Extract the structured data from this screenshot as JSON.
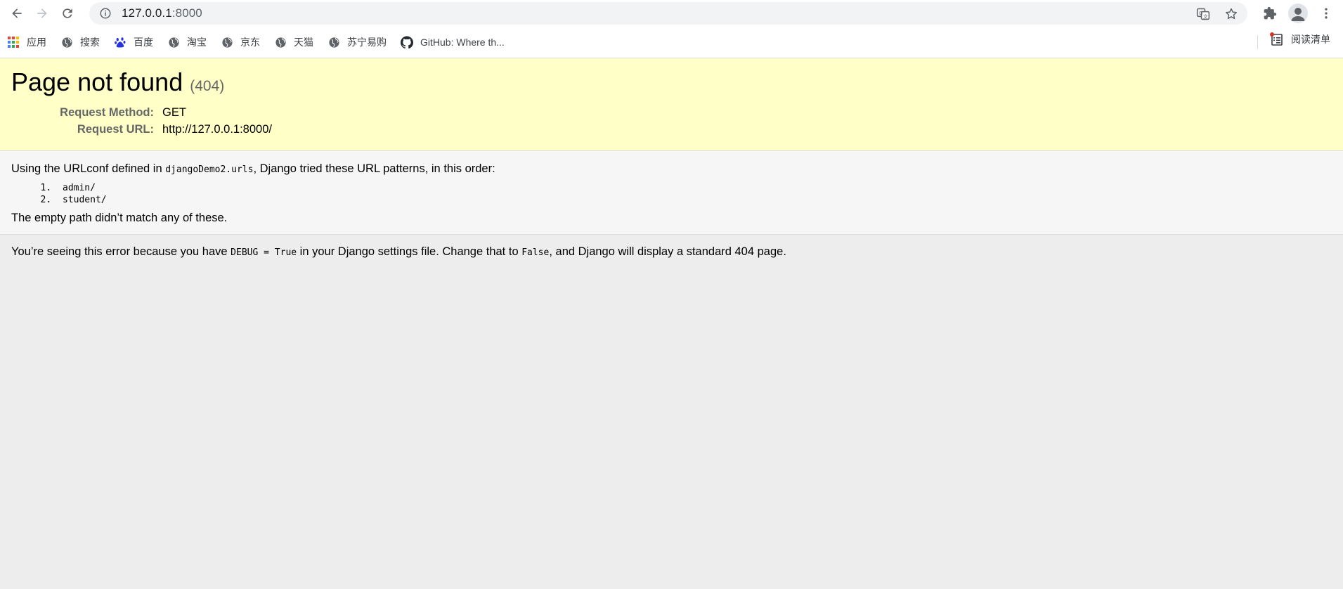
{
  "browser": {
    "url_host": "127.0.0.1",
    "url_port": ":8000",
    "bookmarks": [
      {
        "label": "应用",
        "icon": "apps-grid-icon"
      },
      {
        "label": "搜索",
        "icon": "globe-icon"
      },
      {
        "label": "百度",
        "icon": "baidu-paw-icon"
      },
      {
        "label": "淘宝",
        "icon": "globe-icon"
      },
      {
        "label": "京东",
        "icon": "globe-icon"
      },
      {
        "label": "天猫",
        "icon": "globe-icon"
      },
      {
        "label": "苏宁易购",
        "icon": "globe-icon"
      },
      {
        "label": "GitHub: Where th...",
        "icon": "github-icon"
      }
    ],
    "reading_list_label": "阅读清单"
  },
  "summary": {
    "title": "Page not found",
    "status_code": "(404)",
    "request_method_label": "Request Method:",
    "request_method_value": "GET",
    "request_url_label": "Request URL:",
    "request_url_value": "http://127.0.0.1:8000/"
  },
  "info": {
    "intro_prefix": "Using the URLconf defined in ",
    "urlconf": "djangoDemo2.urls",
    "intro_suffix": ", Django tried these URL patterns, in this order:",
    "patterns": [
      "admin/",
      "student/"
    ],
    "no_match": "The empty path didn’t match any of these."
  },
  "explanation": {
    "part1": "You’re seeing this error because you have ",
    "debug_code": "DEBUG = True",
    "part2": " in your Django settings file. Change that to ",
    "false_code": "False",
    "part3": ", and Django will display a standard 404 page."
  },
  "colors": {
    "summary_bg": "#ffffc8",
    "info_bg": "#f6f6f6",
    "page_bg": "#ededed"
  }
}
